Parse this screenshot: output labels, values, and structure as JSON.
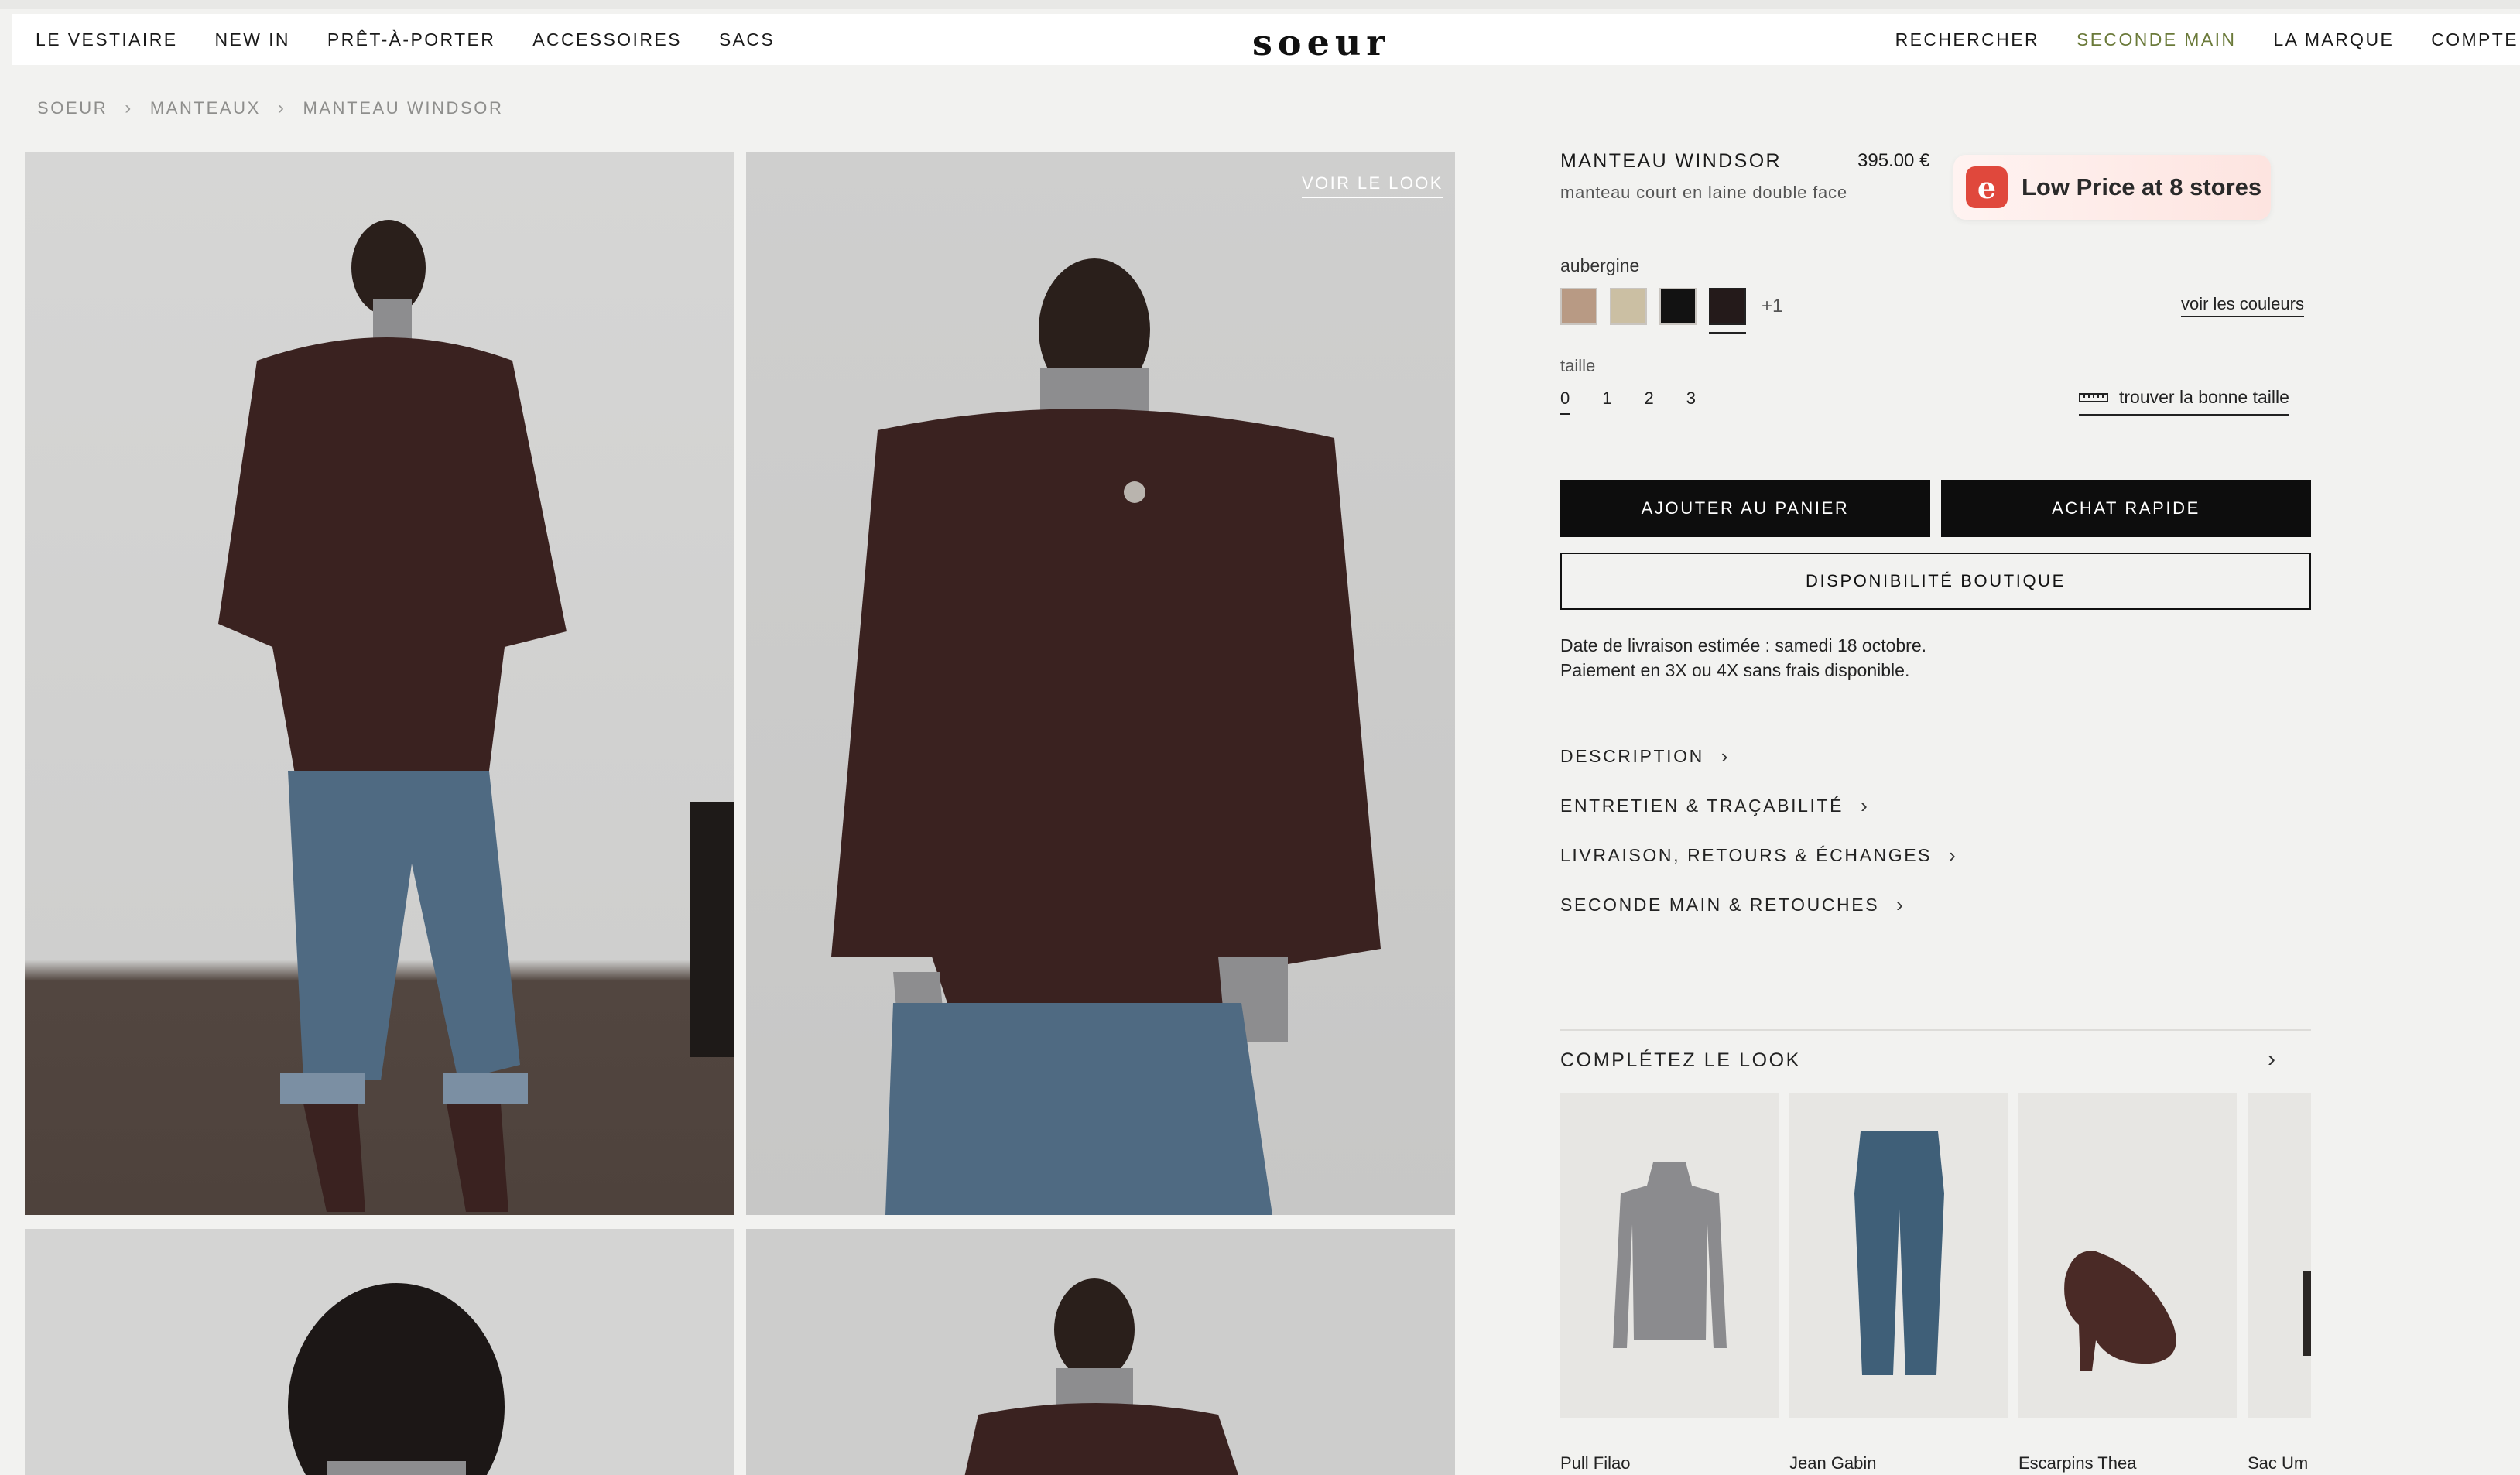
{
  "nav": {
    "left": [
      "LE VESTIAIRE",
      "NEW IN",
      "PRÊT-À-PORTER",
      "ACCESSOIRES",
      "SACS"
    ],
    "logo": "soeur",
    "right": [
      "RECHERCHER",
      "SECONDE MAIN",
      "LA MARQUE",
      "COMPTE"
    ]
  },
  "breadcrumb": [
    "SOEUR",
    "MANTEAUX",
    "MANTEAU WINDSOR"
  ],
  "gallery": {
    "voir_le_look": "VOIR LE LOOK"
  },
  "product": {
    "title": "MANTEAU WINDSOR",
    "price": "395.00 €",
    "subtitle": "manteau court en laine double face",
    "color_name": "aubergine",
    "swatches": [
      "#b89a84",
      "#cbbfa3",
      "#121212",
      "#241a1a"
    ],
    "more_colors": "+1",
    "see_colors": "voir les couleurs",
    "size_label": "taille",
    "sizes": [
      "0",
      "1",
      "2",
      "3"
    ],
    "size_guide": "trouver la bonne taille",
    "add_to_cart": "AJOUTER AU PANIER",
    "quick_buy": "ACHAT RAPIDE",
    "store_availability": "DISPONIBILITÉ BOUTIQUE",
    "delivery_line1": "Date de livraison estimée : samedi 18 octobre.",
    "delivery_line2": "Paiement en 3X ou 4X sans frais disponible.",
    "accordions": [
      "DESCRIPTION",
      "ENTRETIEN & TRAÇABILITÉ",
      "LIVRAISON, RETOURS & ÉCHANGES",
      "SECONDE MAIN & RETOUCHES"
    ]
  },
  "extension": {
    "icon": "e",
    "text": "Low Price at 8 stores",
    "accent": "#e0483c"
  },
  "complete_look": {
    "title": "COMPLÉTEZ LE LOOK",
    "items": [
      "Pull Filao",
      "Jean Gabin",
      "Escarpins Thea",
      "Sac Um"
    ]
  },
  "colors": {
    "accent_nav": "#6b7a3a",
    "button": "#0d0d0d",
    "background": "#f2f2f0"
  }
}
